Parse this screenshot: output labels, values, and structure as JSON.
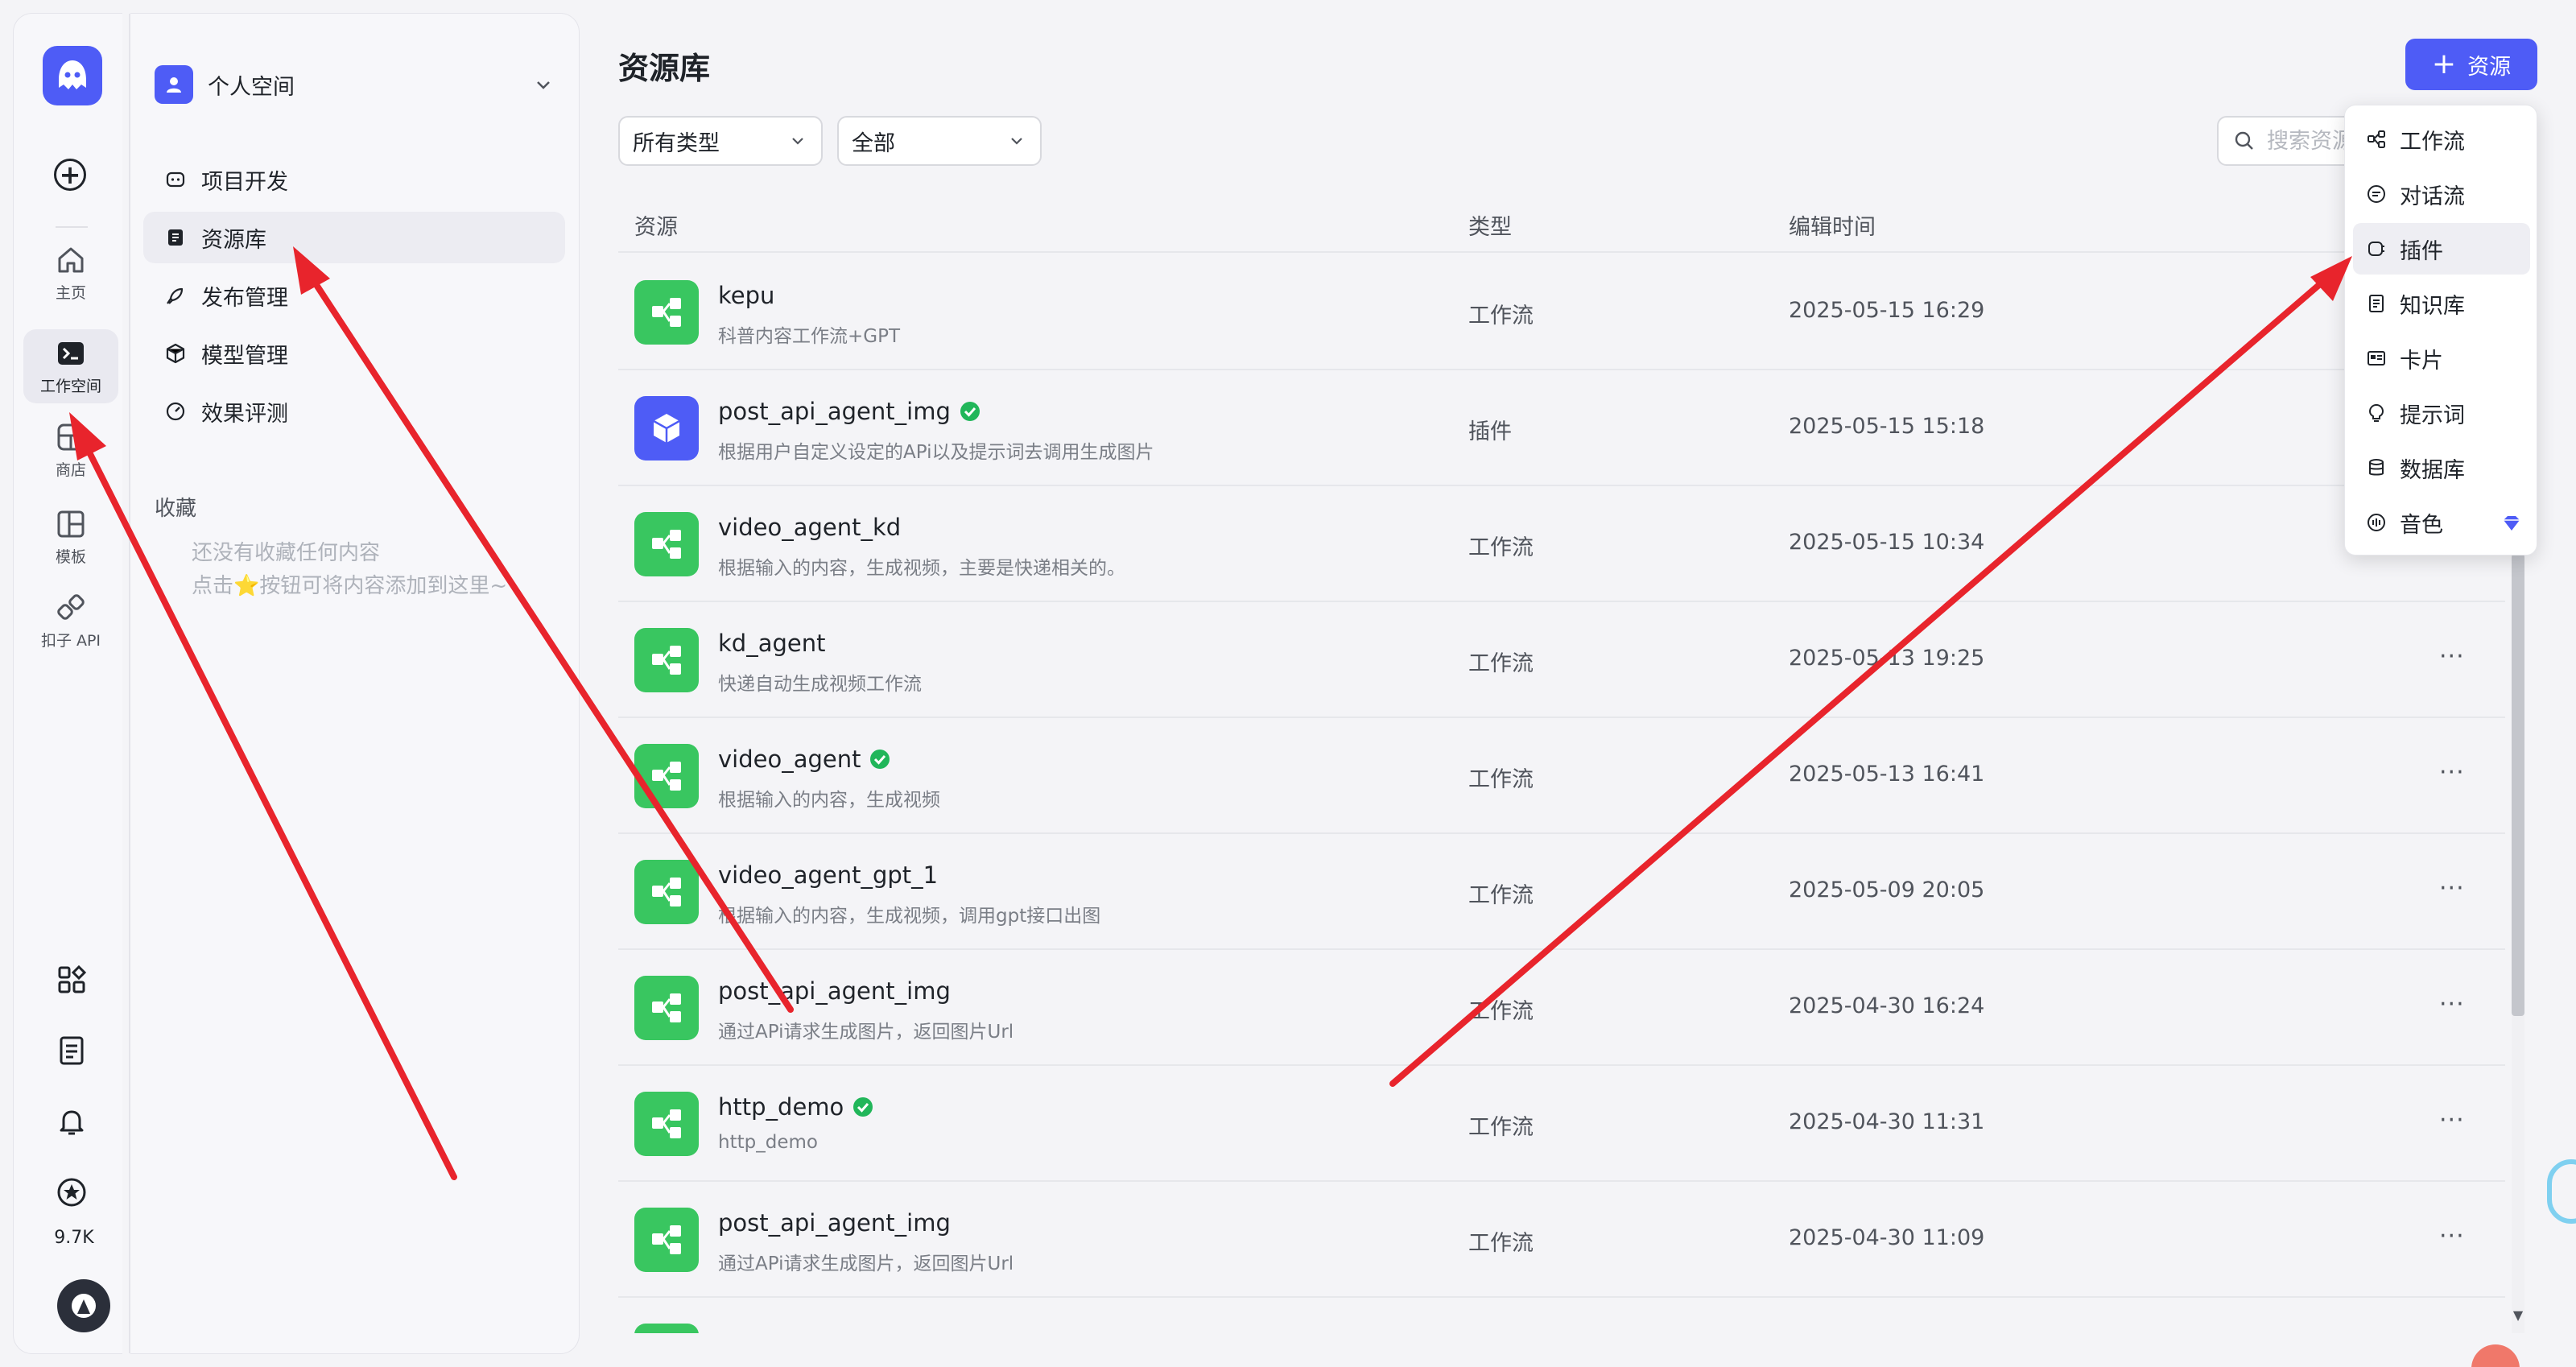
{
  "rail": {
    "items": [
      {
        "label": "主页",
        "icon": "home-icon"
      },
      {
        "label": "工作空间",
        "icon": "terminal-icon",
        "active": true
      },
      {
        "label": "商店",
        "icon": "store-icon"
      },
      {
        "label": "模板",
        "icon": "template-icon"
      },
      {
        "label": "扣子 API",
        "icon": "api-icon"
      }
    ],
    "star_count": "9.7K"
  },
  "sidebar": {
    "workspace_name": "个人空间",
    "nav": [
      {
        "label": "项目开发",
        "icon": "robot-icon"
      },
      {
        "label": "资源库",
        "icon": "book-icon",
        "active": true
      },
      {
        "label": "发布管理",
        "icon": "rocket-icon"
      },
      {
        "label": "模型管理",
        "icon": "cube-icon"
      },
      {
        "label": "效果评测",
        "icon": "gauge-icon"
      }
    ],
    "favorites_title": "收藏",
    "favorites_empty_line1": "还没有收藏任何内容",
    "favorites_empty_line2": "点击⭐按钮可将内容添加到这里~"
  },
  "main": {
    "title": "资源库",
    "add_button": "资源",
    "filter_type": "所有类型",
    "filter_scope": "全部",
    "search_placeholder": "搜索资源",
    "columns": {
      "resource": "资源",
      "type": "类型",
      "edit_time": "编辑时间"
    },
    "rows": [
      {
        "name": "kepu",
        "desc": "科普内容工作流+GPT",
        "type": "工作流",
        "time": "2025-05-15 16:29",
        "kind": "workflow",
        "verified": false
      },
      {
        "name": "post_api_agent_img",
        "desc": "根据用户自定义设定的APi以及提示词去调用生成图片",
        "type": "插件",
        "time": "2025-05-15 15:18",
        "kind": "plugin",
        "verified": true
      },
      {
        "name": "video_agent_kd",
        "desc": "根据输入的内容，生成视频，主要是快递相关的。",
        "type": "工作流",
        "time": "2025-05-15 10:34",
        "kind": "workflow",
        "verified": false
      },
      {
        "name": "kd_agent",
        "desc": "快递自动生成视频工作流",
        "type": "工作流",
        "time": "2025-05-13 19:25",
        "kind": "workflow",
        "verified": false
      },
      {
        "name": "video_agent",
        "desc": "根据输入的内容，生成视频",
        "type": "工作流",
        "time": "2025-05-13 16:41",
        "kind": "workflow",
        "verified": true
      },
      {
        "name": "video_agent_gpt_1",
        "desc": "根据输入的内容，生成视频，调用gpt接口出图",
        "type": "工作流",
        "time": "2025-05-09 20:05",
        "kind": "workflow",
        "verified": false
      },
      {
        "name": "post_api_agent_img",
        "desc": "通过APi请求生成图片，返回图片Url",
        "type": "工作流",
        "time": "2025-04-30 16:24",
        "kind": "workflow",
        "verified": false
      },
      {
        "name": "http_demo",
        "desc": "http_demo",
        "type": "工作流",
        "time": "2025-04-30 11:31",
        "kind": "workflow",
        "verified": true
      },
      {
        "name": "post_api_agent_img",
        "desc": "通过APi请求生成图片，返回图片Url",
        "type": "工作流",
        "time": "2025-04-30 11:09",
        "kind": "workflow",
        "verified": false
      }
    ],
    "more_glyph": "···"
  },
  "menu": {
    "items": [
      {
        "label": "工作流",
        "icon": "workflow-icon"
      },
      {
        "label": "对话流",
        "icon": "chat-icon"
      },
      {
        "label": "插件",
        "icon": "plugin-icon",
        "hover": true
      },
      {
        "label": "知识库",
        "icon": "knowledge-icon"
      },
      {
        "label": "卡片",
        "icon": "card-icon"
      },
      {
        "label": "提示词",
        "icon": "bulb-icon"
      },
      {
        "label": "数据库",
        "icon": "database-icon"
      },
      {
        "label": "音色",
        "icon": "voice-icon",
        "badge": "diamond-icon"
      }
    ]
  },
  "colors": {
    "accent": "#4e5cf6",
    "workflow_green": "#39c660",
    "verified_green": "#21b65a",
    "annotation_red": "#e8242c"
  }
}
